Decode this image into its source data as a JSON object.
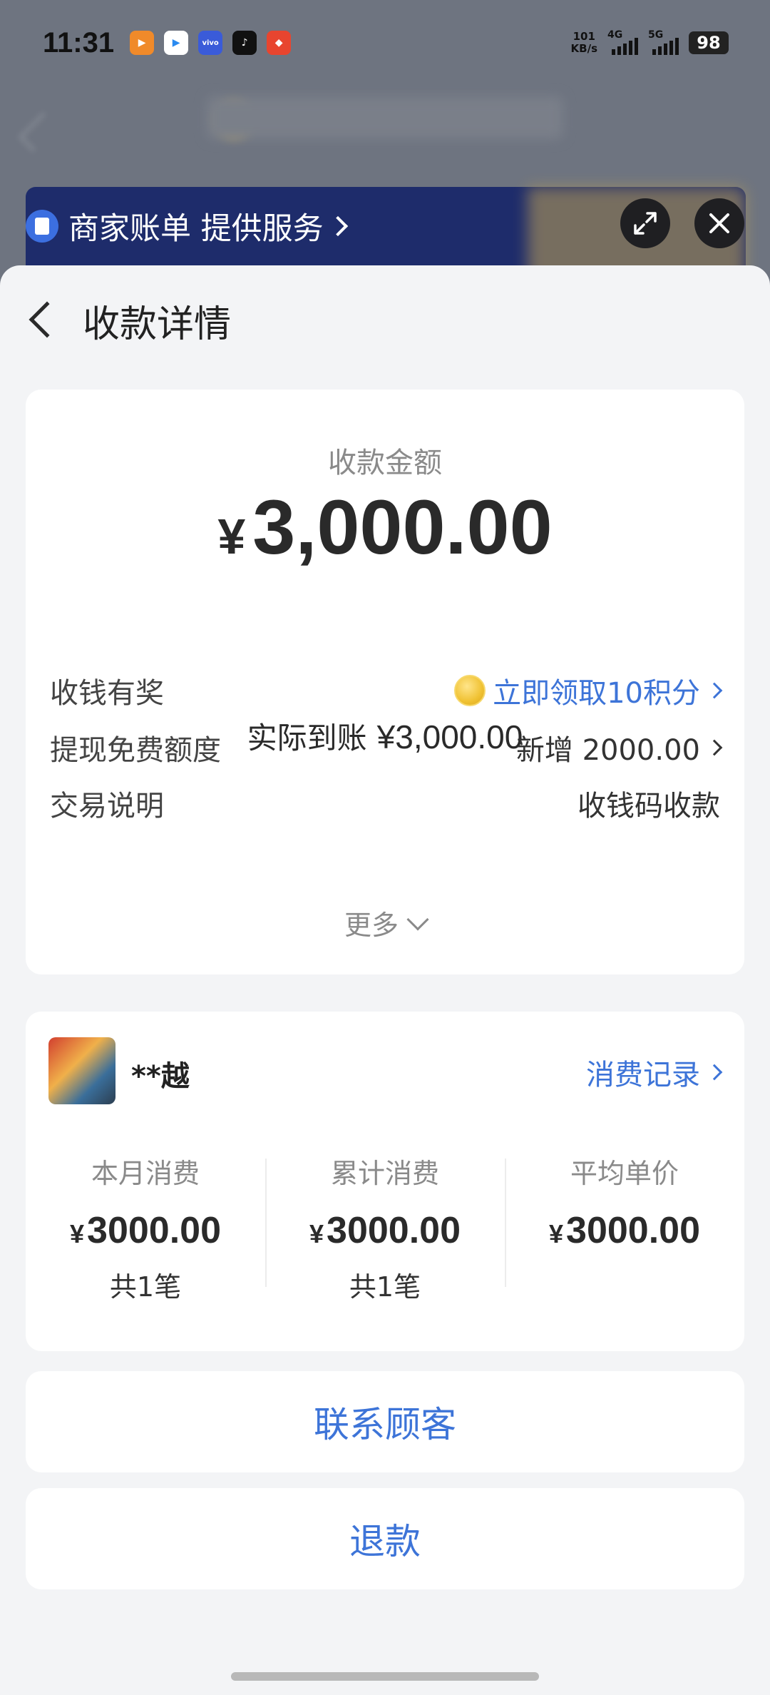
{
  "status_bar": {
    "time": "11:31",
    "net_speed_value": "101",
    "net_speed_unit": "KB/s",
    "sig1_label": "4G",
    "sig2_label": "5G",
    "battery": "98"
  },
  "service": {
    "text": "商家账单 提供服务"
  },
  "header": {
    "title": "收款详情"
  },
  "amount": {
    "label": "收款金额",
    "currency": "¥",
    "value": "3,000.00",
    "actual_label": "实际到账",
    "actual_value": "¥3,000.00"
  },
  "info_rows": [
    {
      "label": "收钱有奖",
      "value": "立即领取10积分"
    },
    {
      "label": "提现免费额度",
      "value": "新增 2000.00"
    },
    {
      "label": "交易说明",
      "value": "收钱码收款"
    }
  ],
  "more": "更多",
  "customer": {
    "name": "**越",
    "records_link": "消费记录",
    "stats": [
      {
        "label": "本月消费",
        "currency": "¥",
        "value": "3000.00",
        "count": "共1笔"
      },
      {
        "label": "累计消费",
        "currency": "¥",
        "value": "3000.00",
        "count": "共1笔"
      },
      {
        "label": "平均单价",
        "currency": "¥",
        "value": "3000.00",
        "count": ""
      }
    ]
  },
  "actions": {
    "contact": "联系顾客",
    "refund": "退款"
  },
  "colors": {
    "accent": "#3d74d8",
    "sheet_bg": "#f3f4f6",
    "card_bg": "#ffffff"
  }
}
